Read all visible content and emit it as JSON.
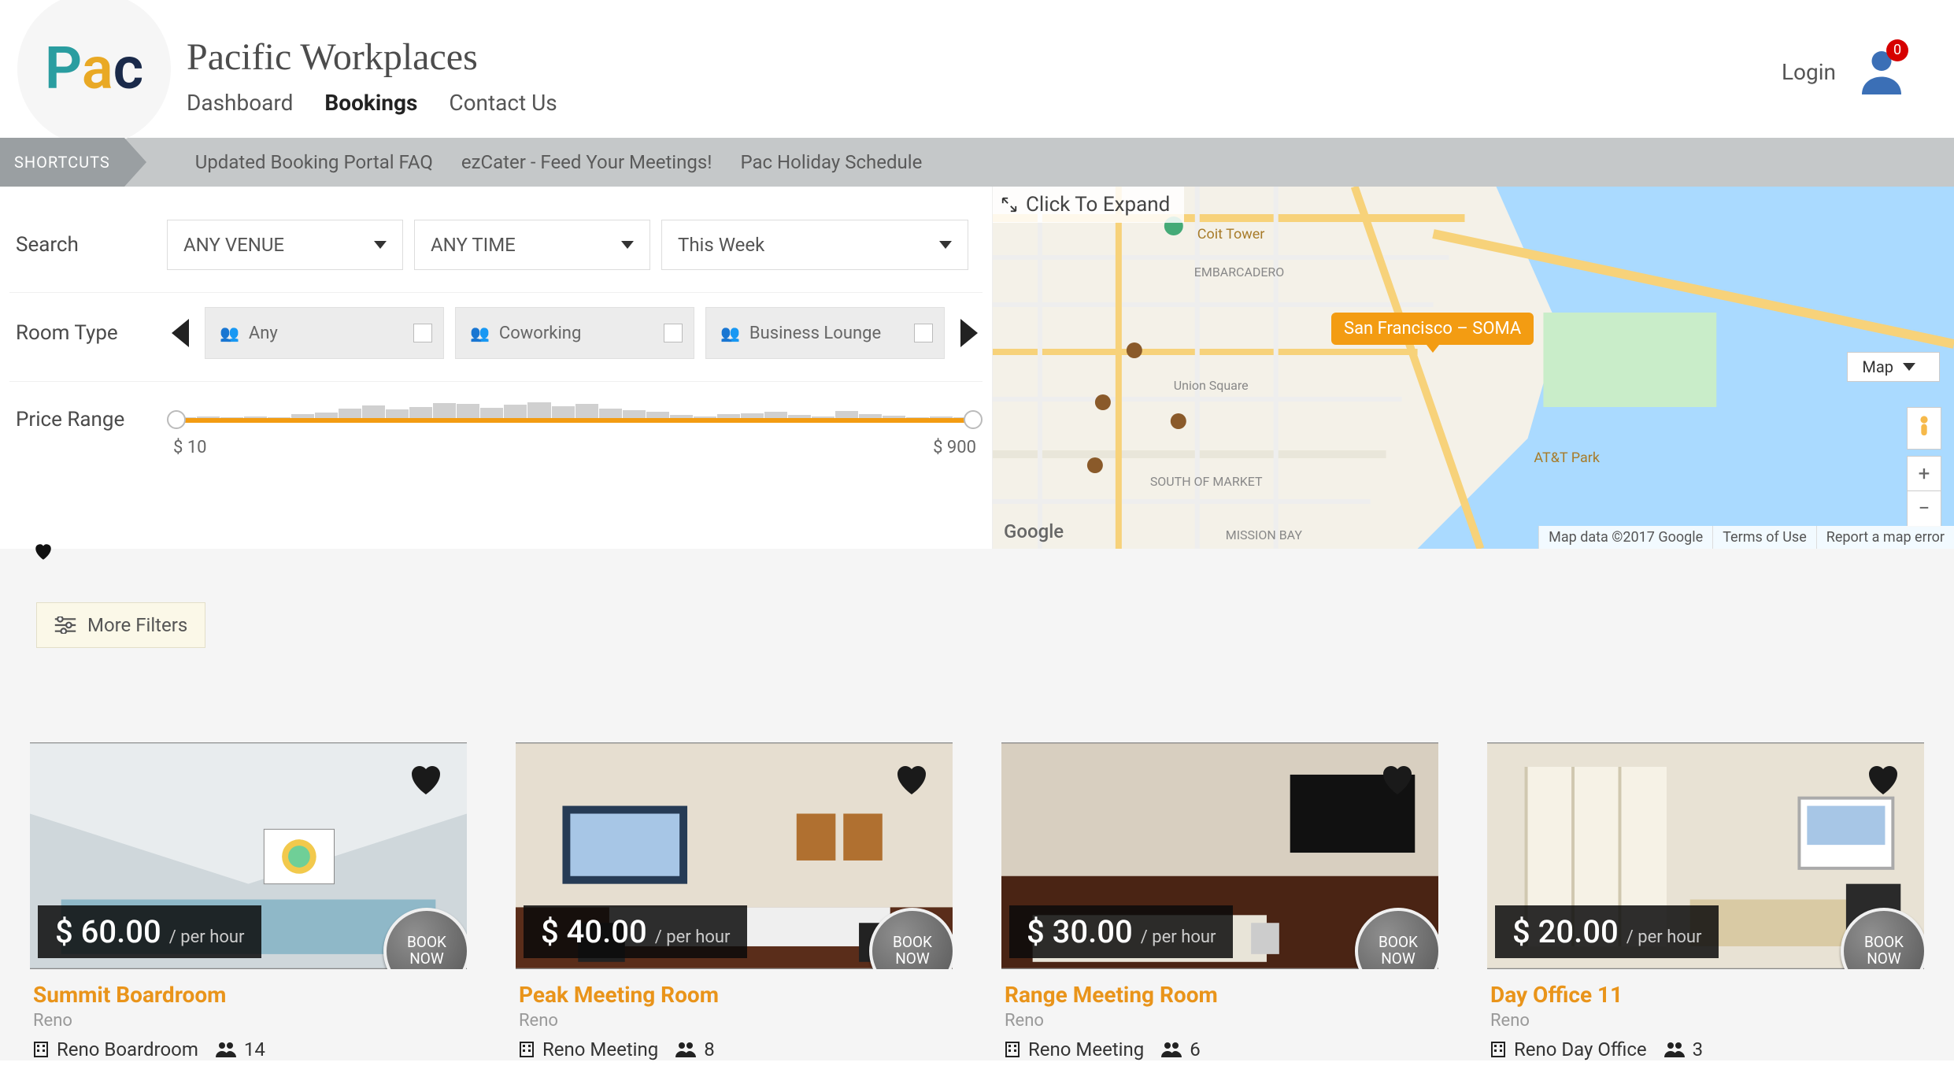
{
  "brand": {
    "title": "Pacific Workplaces"
  },
  "nav": {
    "items": [
      {
        "label": "Dashboard",
        "active": false
      },
      {
        "label": "Bookings",
        "active": true
      },
      {
        "label": "Contact Us",
        "active": false
      }
    ]
  },
  "header": {
    "login": "Login",
    "notif_count": 0
  },
  "shortcuts": {
    "label": "SHORTCUTS",
    "links": [
      "Updated Booking Portal FAQ",
      "ezCater - Feed Your Meetings!",
      "Pac Holiday Schedule"
    ]
  },
  "filters": {
    "search": {
      "label": "Search",
      "venue": "ANY VENUE",
      "time": "ANY TIME",
      "when": "This Week"
    },
    "room_type": {
      "label": "Room Type",
      "options": [
        "Any",
        "Coworking",
        "Business Lounge"
      ]
    },
    "price": {
      "label": "Price Range",
      "min": "$ 10",
      "max": "$ 900"
    }
  },
  "map": {
    "expand": "Click To Expand",
    "pin": "San Francisco – SOMA",
    "type": "Map",
    "attribution": [
      "Map data ©2017 Google",
      "Terms of Use",
      "Report a map error"
    ],
    "logo": "Google"
  },
  "more_filters": "More Filters",
  "book_label": "BOOK NOW",
  "results": [
    {
      "title": "Summit Boardroom",
      "location": "Reno",
      "venue_short": "Reno Boardroom",
      "capacity": 14,
      "price": "$ 60.00",
      "per": "/ per hour"
    },
    {
      "title": "Peak Meeting Room",
      "location": "Reno",
      "venue_short": "Reno Meeting",
      "capacity": 8,
      "price": "$ 40.00",
      "per": "/ per hour"
    },
    {
      "title": "Range Meeting Room",
      "location": "Reno",
      "venue_short": "Reno Meeting",
      "capacity": 6,
      "price": "$ 30.00",
      "per": "/ per hour"
    },
    {
      "title": "Day Office 11",
      "location": "Reno",
      "venue_short": "Reno Day Office",
      "capacity": 3,
      "price": "$ 20.00",
      "per": "/ per hour"
    }
  ]
}
